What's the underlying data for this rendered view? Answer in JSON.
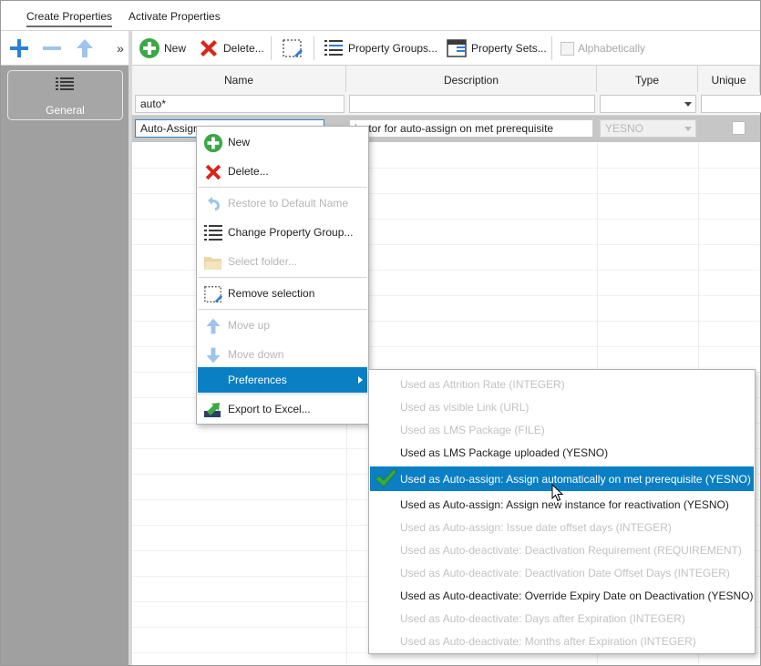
{
  "tabs": [
    {
      "label": "Create Properties",
      "active": true
    },
    {
      "label": "Activate Properties",
      "active": false
    }
  ],
  "left_toolbar": {
    "add_icon": "plus-icon",
    "remove_icon": "minus-icon",
    "up_icon": "arrow-up-icon",
    "more_label": "»"
  },
  "left_panel": {
    "group_label": "General",
    "group_icon": "list-icon"
  },
  "toolbar": {
    "new_label": "New",
    "delete_label": "Delete...",
    "property_groups_label": "Property Groups...",
    "property_sets_label": "Property Sets...",
    "alphabetically_label": "Alphabetically"
  },
  "grid": {
    "columns": [
      "Name",
      "Description",
      "Type",
      "Unique"
    ],
    "filter": {
      "name": "auto*",
      "description": "",
      "type": ""
    },
    "row": {
      "name": "Auto-Assign",
      "description": "icator for auto-assign on met prerequisite",
      "type": "YESNO"
    }
  },
  "context_menu": {
    "items": [
      {
        "label": "New",
        "icon": "plus-circle-icon",
        "enabled": true
      },
      {
        "label": "Delete...",
        "icon": "red-x-icon",
        "enabled": true
      },
      {
        "label": "Restore to Default Name",
        "icon": "undo-icon",
        "enabled": false
      },
      {
        "label": "Change Property Group...",
        "icon": "list-icon",
        "enabled": true
      },
      {
        "label": "Select folder...",
        "icon": "folder-icon",
        "enabled": false
      },
      {
        "label": "Remove selection",
        "icon": "remove-selection-icon",
        "enabled": true
      },
      {
        "label": "Move up",
        "icon": "arrow-up-icon",
        "enabled": false
      },
      {
        "label": "Move down",
        "icon": "arrow-down-icon",
        "enabled": false
      },
      {
        "label": "Preferences",
        "icon": "",
        "enabled": true
      },
      {
        "label": "Export to Excel...",
        "icon": "excel-export-icon",
        "enabled": true
      }
    ]
  },
  "preferences_submenu": {
    "items": [
      {
        "label": "Used as Attrition Rate (INTEGER)",
        "enabled": false,
        "checked": false
      },
      {
        "label": "Used as visible Link (URL)",
        "enabled": false,
        "checked": false
      },
      {
        "label": "Used as LMS Package (FILE)",
        "enabled": false,
        "checked": false
      },
      {
        "label": "Used as LMS Package uploaded (YESNO)",
        "enabled": true,
        "checked": false
      },
      {
        "label": "Used as Auto-assign: Assign automatically on met prerequisite (YESNO)",
        "enabled": true,
        "checked": true
      },
      {
        "label": "Used as Auto-assign: Assign new instance for reactivation (YESNO)",
        "enabled": true,
        "checked": false
      },
      {
        "label": "Used as Auto-assign: Issue date offset days (INTEGER)",
        "enabled": false,
        "checked": false
      },
      {
        "label": "Used as Auto-deactivate: Deactivation Requirement (REQUIREMENT)",
        "enabled": false,
        "checked": false
      },
      {
        "label": "Used as Auto-deactivate: Deactivation Date Offset Days (INTEGER)",
        "enabled": false,
        "checked": false
      },
      {
        "label": "Used as Auto-deactivate: Override Expiry Date on Deactivation (YESNO)",
        "enabled": true,
        "checked": false
      },
      {
        "label": "Used as Auto-deactivate: Days after Expiration (INTEGER)",
        "enabled": false,
        "checked": false
      },
      {
        "label": "Used as Auto-deactivate: Months after Expiration (INTEGER)",
        "enabled": false,
        "checked": false
      }
    ]
  },
  "colors": {
    "accent": "#0a7fc4",
    "left_panel": "#a0a0a0",
    "selected_row": "#c6c6c6",
    "icon_blue": "#2b7fd6",
    "icon_green": "#3aa845",
    "icon_red": "#d9261c"
  }
}
